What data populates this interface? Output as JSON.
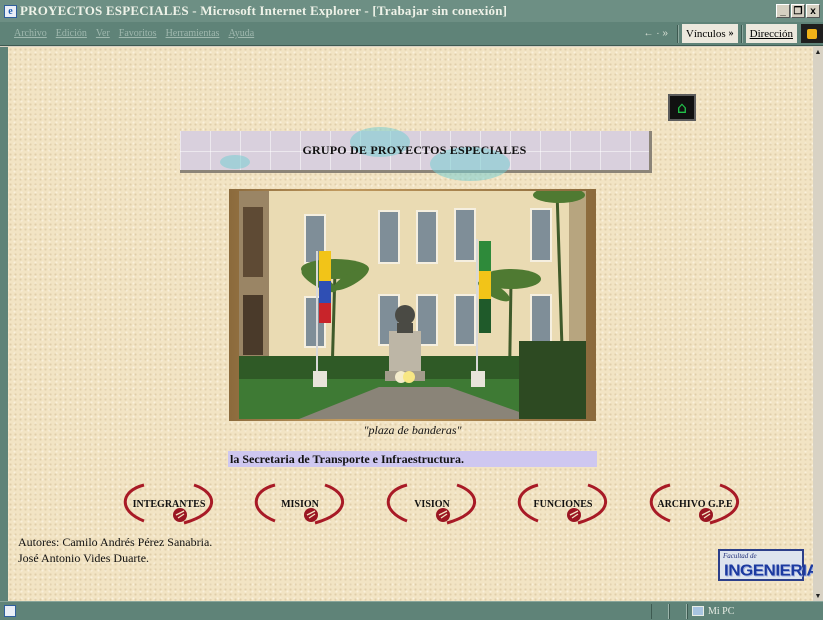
{
  "window": {
    "title": "PROYECTOS ESPECIALES - Microsoft Internet Explorer - [Trabajar sin conexión]",
    "controls": [
      "_",
      "❐",
      "x"
    ]
  },
  "menubar": {
    "items": [
      "Archivo",
      "Edición",
      "Ver",
      "Favoritos",
      "Herramientas",
      "Ayuda"
    ],
    "nav_arrows": "← · »",
    "links_label": "Vínculos",
    "address_label": "Dirección",
    "chevron": "»"
  },
  "page": {
    "banner_title": "GRUPO DE PROYECTOS ESPECIALES",
    "photo_caption": "\"plaza de banderas\"",
    "marquee_text": "la Secretaria de Transporte e Infraestructura.",
    "nav_buttons": [
      "INTEGRANTES",
      "MISION",
      "VISION",
      "FUNCIONES",
      "ARCHIVO G.P.E"
    ],
    "authors_label": "Autores:",
    "author_1": "Camilo Andrés Pérez Sanabria.",
    "author_2": "José Antonio Vides Duarte.",
    "logo_small": "Facultad de",
    "logo_big": "INGENIERIA"
  },
  "statusbar": {
    "zone": "Mi PC"
  },
  "colors": {
    "chrome": "#5f8378",
    "page_bg": "#f2e4c4",
    "marquee_bg": "#cec7f0",
    "swoosh": "#b5192a"
  }
}
